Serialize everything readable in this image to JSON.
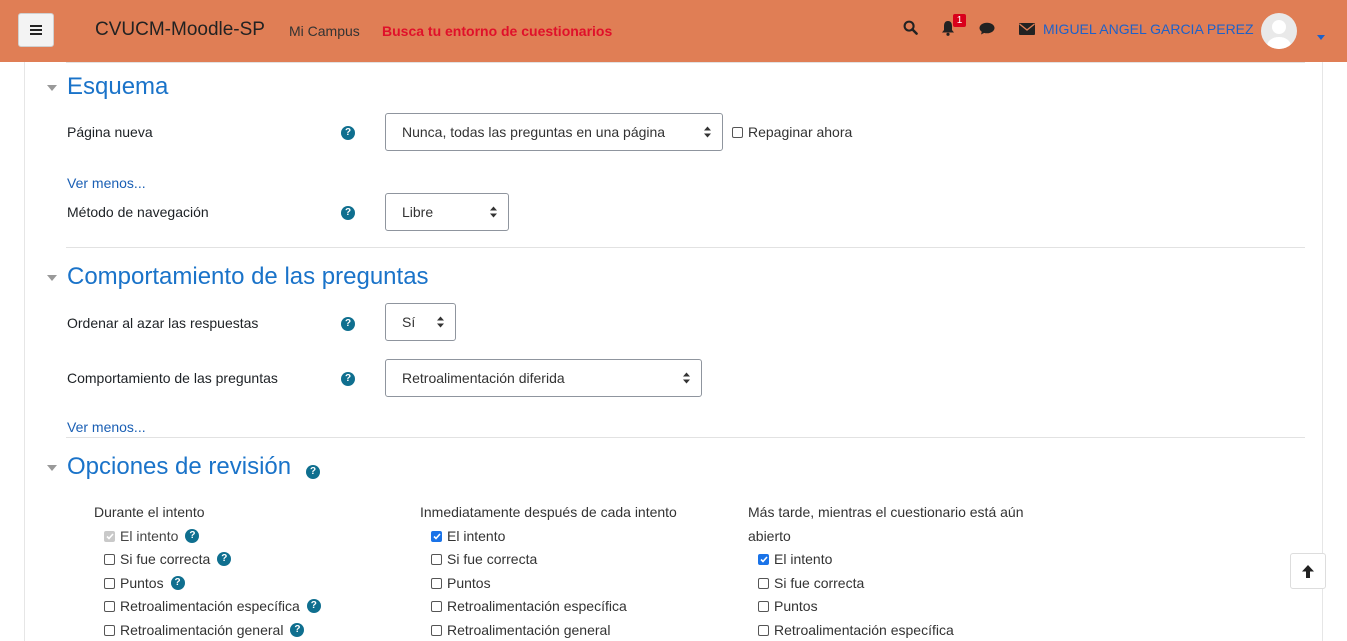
{
  "navbar": {
    "brand": "CVUCM-Moodle-SP",
    "campus_link": "Mi Campus",
    "search_link": "Busca tu entorno de cuestionarios",
    "notification_count": "1",
    "username": "MIGUEL ANGEL GARCIA PEREZ",
    "icons": [
      "menu-icon",
      "search-icon",
      "bell-icon",
      "chat-icon",
      "envelope-icon",
      "avatar",
      "caret-down-icon"
    ],
    "colors": {
      "bar": "#e07e55",
      "brand_text": "#222222",
      "search_link": "#e0102a",
      "username": "#1e61c9"
    }
  },
  "esquema": {
    "title": "Esquema",
    "pagina_nueva_label": "Página nueva",
    "pagina_nueva_value": "Nunca, todas las preguntas en una página",
    "repaginar_label": "Repaginar ahora",
    "ver_menos": "Ver menos...",
    "metodo_label": "Método de navegación",
    "metodo_value": "Libre"
  },
  "comportamiento": {
    "title": "Comportamiento de las preguntas",
    "ordenar_label": "Ordenar al azar las respuestas",
    "ordenar_value": "Sí",
    "comportamiento_label": "Comportamiento de las preguntas",
    "comportamiento_value": "Retroalimentación diferida",
    "ver_menos": "Ver menos..."
  },
  "revision": {
    "title": "Opciones de revisión",
    "columns": [
      {
        "header": "Durante el intento",
        "items": [
          {
            "label": "El intento",
            "state": "checked-disabled",
            "help": true
          },
          {
            "label": "Si fue correcta",
            "state": "unchecked",
            "help": true
          },
          {
            "label": "Puntos",
            "state": "unchecked",
            "help": true
          },
          {
            "label": "Retroalimentación específica",
            "state": "unchecked",
            "help": true
          },
          {
            "label": "Retroalimentación general",
            "state": "unchecked",
            "help": true
          }
        ]
      },
      {
        "header": "Inmediatamente después de cada intento",
        "items": [
          {
            "label": "El intento",
            "state": "checked"
          },
          {
            "label": "Si fue correcta",
            "state": "unchecked"
          },
          {
            "label": "Puntos",
            "state": "unchecked"
          },
          {
            "label": "Retroalimentación específica",
            "state": "unchecked"
          },
          {
            "label": "Retroalimentación general",
            "state": "unchecked"
          }
        ]
      },
      {
        "header_line1": "Más tarde, mientras el cuestionario está aún",
        "header_line2": "abierto",
        "items": [
          {
            "label": "El intento",
            "state": "checked"
          },
          {
            "label": "Si fue correcta",
            "state": "unchecked"
          },
          {
            "label": "Puntos",
            "state": "unchecked"
          },
          {
            "label": "Retroalimentación específica",
            "state": "unchecked"
          }
        ]
      }
    ]
  },
  "help_glyph": "?",
  "accent_color": "#1a73c9"
}
